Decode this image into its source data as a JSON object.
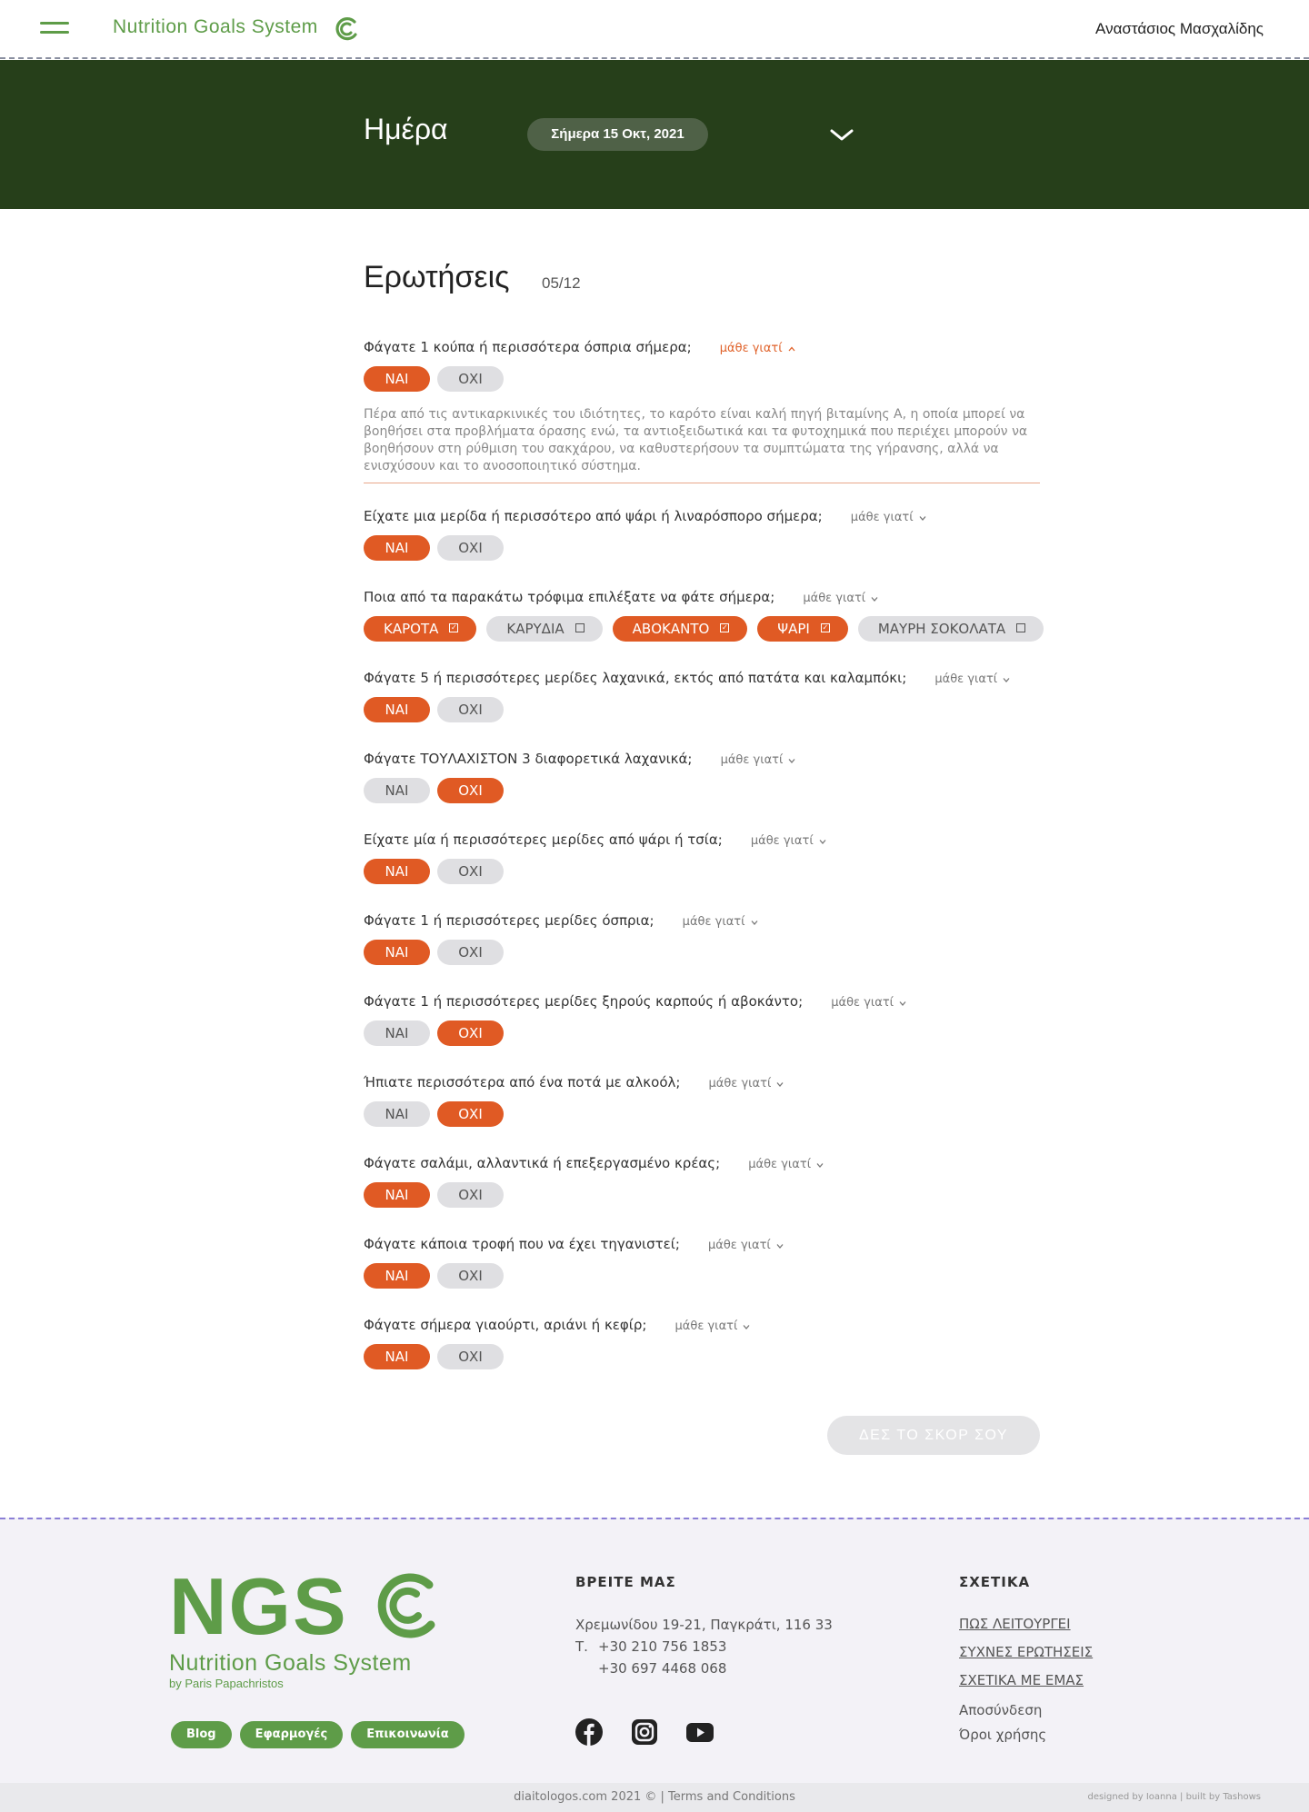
{
  "header": {
    "brand": "Nutrition Goals System",
    "user_name": "Αναστάσιος Μασχαλίδης"
  },
  "day": {
    "title": "Ημέρα",
    "date_label": "Σήμερα 15 Οκτ, 2021"
  },
  "questions_header": {
    "title": "Ερωτήσεις",
    "count": "05/12"
  },
  "why_label": "μάθε γιατί",
  "yes_label": "ΝΑΙ",
  "no_label": "ΟΧΙ",
  "questions": [
    {
      "text": "Φάγατε 1 κούπα ή περισσότερα όσπρια σήμερα;",
      "answer": "yes",
      "why_open": true,
      "explanation": "Πέρα από τις αντικαρκινικές του ιδιότητες, το καρότο είναι καλή πηγή βιταμίνης Α, η οποία μπορεί να βοηθήσει στα προβλήματα όρασης ενώ, τα αντιοξειδωτικά και τα φυτοχημικά που περιέχει μπορούν να βοηθήσουν στη ρύθμιση του σακχάρου, να καθυστερήσουν τα συμπτώματα της γήρανσης, αλλά να ενισχύσουν και το ανοσοποιητικό σύστημα."
    },
    {
      "text": "Είχατε μια μερίδα ή περισσότερο από ψάρι ή λιναρόσπορο σήμερα;",
      "answer": "yes"
    },
    {
      "text": "Ποια από τα παρακάτω τρόφιμα επιλέξατε να φάτε σήμερα;",
      "foods": [
        {
          "label": "ΚΑΡΟΤΑ",
          "selected": true
        },
        {
          "label": "ΚΑΡΥΔΙΑ",
          "selected": false
        },
        {
          "label": "ΑΒΟΚΑΝΤΟ",
          "selected": true
        },
        {
          "label": "ΨΑΡΙ",
          "selected": true
        },
        {
          "label": "ΜΑΥΡΗ ΣΟΚΟΛΑΤΑ",
          "selected": false
        }
      ]
    },
    {
      "text": "Φάγατε 5 ή περισσότερες μερίδες λαχανικά, εκτός από πατάτα και καλαμπόκι;",
      "answer": "yes"
    },
    {
      "text": "Φάγατε ΤΟΥΛΑΧΙΣΤΟΝ 3 διαφορετικά λαχανικά;",
      "answer": "no"
    },
    {
      "text": "Είχατε μία ή περισσότερες μερίδες από ψάρι ή τσία;",
      "answer": "yes"
    },
    {
      "text": "Φάγατε 1 ή περισσότερες μερίδες όσπρια;",
      "answer": "yes"
    },
    {
      "text": "Φάγατε 1 ή περισσότερες μερίδες ξηρούς καρπούς ή αβοκάντο;",
      "answer": "no"
    },
    {
      "text": "Ήπιατε περισσότερα από ένα ποτά με αλκοόλ;",
      "answer": "no"
    },
    {
      "text": "Φάγατε σαλάμι, αλλαντικά ή επεξεργασμένο κρέας;",
      "answer": "yes"
    },
    {
      "text": "Φάγατε κάποια τροφή που να έχει τηγανιστεί;",
      "answer": "yes"
    },
    {
      "text": "Φάγατε σήμερα γιαούρτι, αριάνι ή κεφίρ;",
      "answer": "yes"
    }
  ],
  "score_button": "ΔΕΣ ΤΟ ΣΚΟΡ ΣΟΥ",
  "footer": {
    "logo_text": "NGS",
    "logo_name": "Nutrition Goals System",
    "logo_by": "by Paris Papachristos",
    "buttons": [
      "Blog",
      "Εφαρμογές",
      "Επικοινωνία"
    ],
    "find_us_title": "ΒΡΕΙΤΕ ΜΑΣ",
    "address": "Χρεμωνίδου 19-21, Παγκράτι, 116 33",
    "phone_label": "Τ.",
    "phone1": "+30 210 756 1853",
    "phone2": "+30 697 4468 068",
    "socials": [
      "facebook-icon",
      "instagram-icon",
      "youtube-icon"
    ],
    "about_title": "ΣΧΕΤΙΚΑ",
    "about_links": [
      "ΠΩΣ ΛΕΙΤΟΥΡΓΕΙ",
      "ΣΥΧΝΕΣ ΕΡΩΤΗΣΕΙΣ",
      "ΣΧΕΤΙΚΑ ΜΕ ΕΜΑΣ"
    ],
    "logout": "Αποσύνδεση",
    "terms": "Όροι χρήσης",
    "copyright": "diaitologos.com 2021 © |",
    "terms_link": "Terms and Conditions",
    "credit": "designed by Ioanna | built by Tashows"
  },
  "colors": {
    "brand_green": "#5e9c48",
    "dark_green": "#263f1a",
    "accent_orange": "#e05a24",
    "pill_grey": "#dfdfe2"
  }
}
